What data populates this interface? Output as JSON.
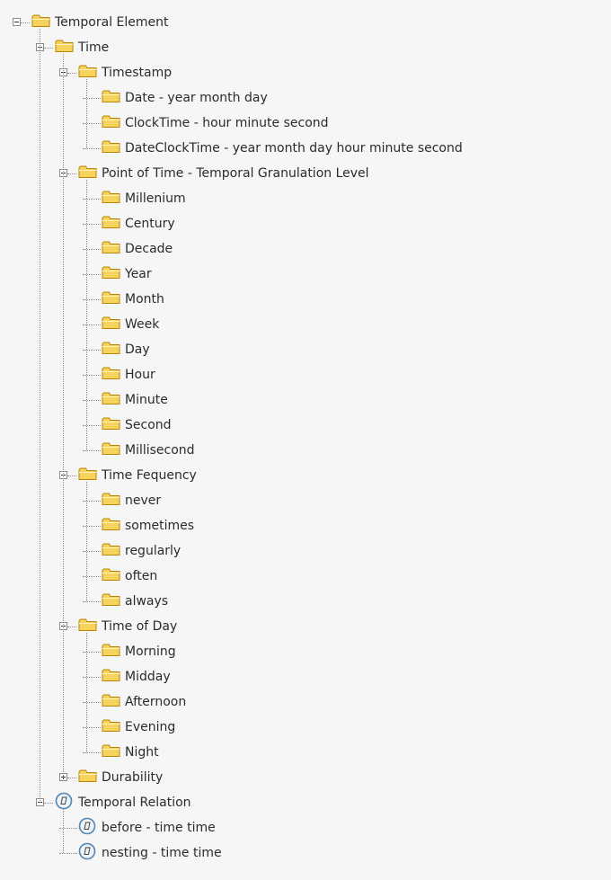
{
  "tree": {
    "label": "Temporal Element",
    "icon": "folder-icon",
    "expanded": true,
    "children": [
      {
        "label": "Time",
        "icon": "folder-icon",
        "expanded": true,
        "children": [
          {
            "label": "Timestamp",
            "icon": "folder-icon",
            "expanded": true,
            "children": [
              {
                "label": "Date - year month day",
                "icon": "folder-icon"
              },
              {
                "label": "ClockTime - hour minute second",
                "icon": "folder-icon"
              },
              {
                "label": "DateClockTime - year month day hour minute second",
                "icon": "folder-icon"
              }
            ]
          },
          {
            "label": "Point of Time - Temporal Granulation Level",
            "icon": "folder-icon",
            "expanded": true,
            "children": [
              {
                "label": "Millenium",
                "icon": "folder-icon"
              },
              {
                "label": "Century",
                "icon": "folder-icon"
              },
              {
                "label": "Decade",
                "icon": "folder-icon"
              },
              {
                "label": "Year",
                "icon": "folder-icon"
              },
              {
                "label": "Month",
                "icon": "folder-icon"
              },
              {
                "label": "Week",
                "icon": "folder-icon"
              },
              {
                "label": "Day",
                "icon": "folder-icon"
              },
              {
                "label": "Hour",
                "icon": "folder-icon"
              },
              {
                "label": "Minute",
                "icon": "folder-icon"
              },
              {
                "label": "Second",
                "icon": "folder-icon"
              },
              {
                "label": "Millisecond",
                "icon": "folder-icon"
              }
            ]
          },
          {
            "label": "Time Fequency",
            "icon": "folder-icon",
            "expanded": true,
            "children": [
              {
                "label": "never",
                "icon": "folder-icon"
              },
              {
                "label": "sometimes",
                "icon": "folder-icon"
              },
              {
                "label": "regularly",
                "icon": "folder-icon"
              },
              {
                "label": "often",
                "icon": "folder-icon"
              },
              {
                "label": "always",
                "icon": "folder-icon"
              }
            ]
          },
          {
            "label": "Time of Day",
            "icon": "folder-icon",
            "expanded": true,
            "children": [
              {
                "label": "Morning",
                "icon": "folder-icon"
              },
              {
                "label": "Midday",
                "icon": "folder-icon"
              },
              {
                "label": "Afternoon",
                "icon": "folder-icon"
              },
              {
                "label": "Evening",
                "icon": "folder-icon"
              },
              {
                "label": "Night",
                "icon": "folder-icon"
              }
            ]
          },
          {
            "label": "Durability",
            "icon": "folder-icon",
            "expanded": false,
            "collapsed_has_children": true
          }
        ]
      },
      {
        "label": "Temporal Relation",
        "icon": "relation-icon",
        "expanded": true,
        "children": [
          {
            "label": "before - time time",
            "icon": "relation-icon"
          },
          {
            "label": "nesting - time time",
            "icon": "relation-icon"
          }
        ]
      }
    ]
  },
  "colors": {
    "background": "#f6f6f6",
    "text": "#2b2b2b",
    "connector": "#8a8a8a",
    "folder_fill": "#f7d25c",
    "folder_stroke": "#b8860b",
    "relation_ring": "#4f86b5"
  }
}
